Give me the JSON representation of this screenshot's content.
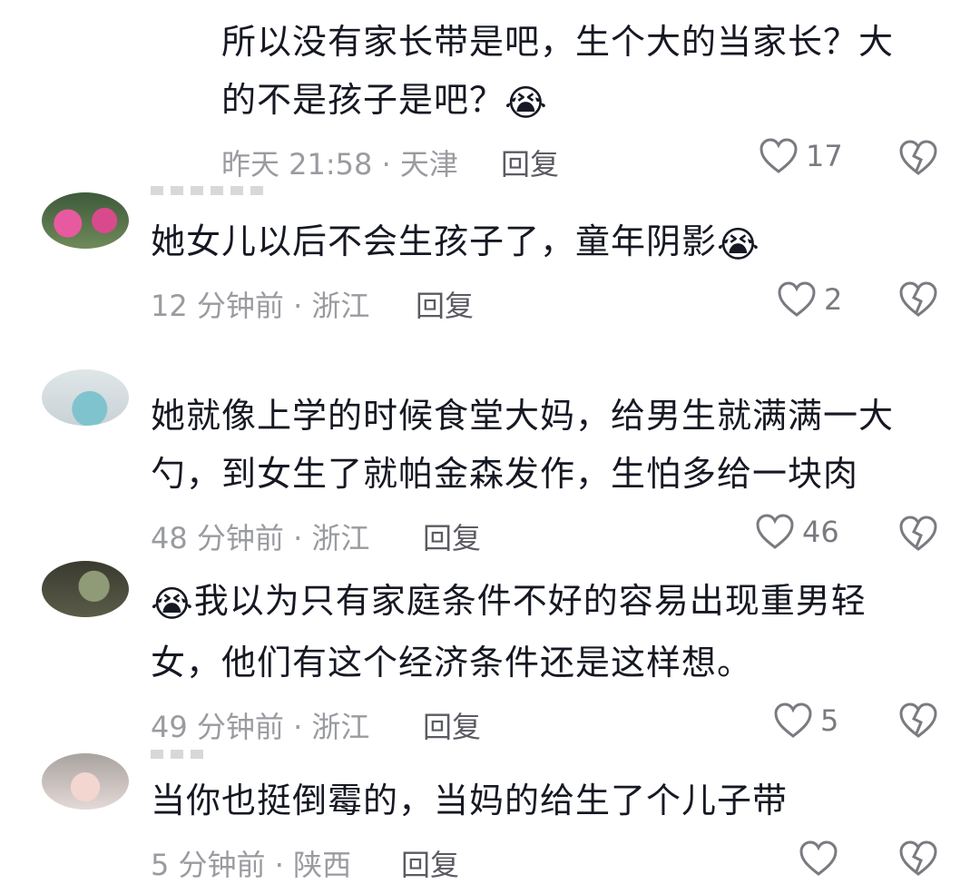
{
  "comments": [
    {
      "text_line1": "所以没有家长带是吧，生个大的当家长？大",
      "text_line2": "的不是孩子是吧？",
      "emoji": "😭",
      "time": "昨天 21:58",
      "location": "天津",
      "reply_label": "回复",
      "likes": "17"
    },
    {
      "text_line1": "她女儿以后不会生孩子了，童年阴影",
      "emoji": "😭",
      "time": "12 分钟前",
      "location": "浙江",
      "reply_label": "回复",
      "likes": "2"
    },
    {
      "text_line1": "她就像上学的时候食堂大妈，给男生就满满一大",
      "text_line2": "勺，到女生了就帕金森发作，生怕多给一块肉",
      "time": "48 分钟前",
      "location": "浙江",
      "reply_label": "回复",
      "likes": "46"
    },
    {
      "emoji": "😭",
      "text_line1": "我以为只有家庭条件不好的容易出现重男轻",
      "text_line2": "女，他们有这个经济条件还是这样想。",
      "time": "49 分钟前",
      "location": "浙江",
      "reply_label": "回复",
      "likes": "5"
    },
    {
      "text_line1": "当你也挺倒霉的，当妈的给生了个儿子带",
      "time": "5 分钟前",
      "location": "陕西",
      "reply_label": "回复",
      "likes": ""
    }
  ],
  "meta_separator": " · ",
  "icons": {
    "like": "heart-outline-icon",
    "dislike": "broken-heart-icon",
    "emoji": "laughing-crying-emoji"
  },
  "colors": {
    "text": "#161823",
    "meta": "#9a9ba0",
    "reply": "#5a5b62"
  }
}
